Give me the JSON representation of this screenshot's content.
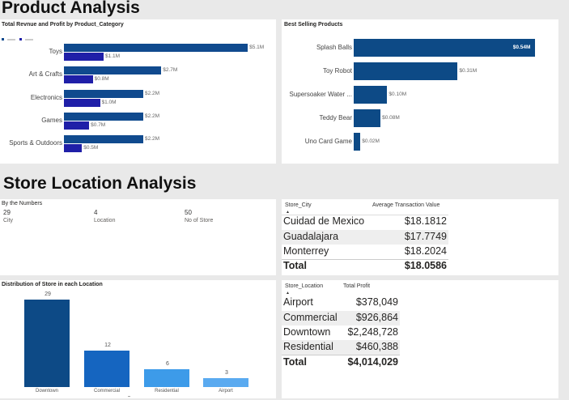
{
  "sections": {
    "product_title": "Product Analysis",
    "store_title": "Store Location Analysis"
  },
  "revenue_chart": {
    "title": "Total Revnue and Profit by Product_Category",
    "colors": {
      "revenue": "#104a8e",
      "profit": "#1f1fa8"
    }
  },
  "best_selling": {
    "title": "Best Selling Products",
    "color": "#0d4a86"
  },
  "numbers": {
    "title": "By the Numbers",
    "items": [
      {
        "value": "29",
        "label": "City"
      },
      {
        "value": "4",
        "label": "Location"
      },
      {
        "value": "50",
        "label": "No of Store"
      }
    ]
  },
  "city_table": {
    "headers": [
      "Store_City",
      "Average Transaction Value"
    ],
    "rows": [
      [
        "Cuidad de Mexico",
        "$18.1812"
      ],
      [
        "Guadalajara",
        "$17.7749"
      ],
      [
        "Monterrey",
        "$18.2024"
      ]
    ],
    "total": [
      "Total",
      "$18.0586"
    ]
  },
  "location_table": {
    "headers": [
      "Store_Location",
      "Total Profit"
    ],
    "rows": [
      [
        "Airport",
        "$378,049"
      ],
      [
        "Commercial",
        "$926,864"
      ],
      [
        "Downtown",
        "$2,248,728"
      ],
      [
        "Residential",
        "$460,388"
      ]
    ],
    "total": [
      "Total",
      "$4,014,029"
    ]
  },
  "distribution": {
    "title": "Distribution of Store in each Location",
    "colors": [
      "#0d4a86",
      "#1565c0",
      "#3d9be9",
      "#5aaaf0"
    ]
  },
  "chart_data": [
    {
      "type": "bar",
      "orientation": "horizontal",
      "title": "Total Revnue and Profit by Product_Category",
      "categories": [
        "Toys",
        "Art & Crafts",
        "Electronics",
        "Games",
        "Sports & Outdoors"
      ],
      "series": [
        {
          "values": [
            5.1,
            2.7,
            2.2,
            2.2,
            2.2
          ],
          "labels": [
            "$5.1M",
            "$2.7M",
            "$2.2M",
            "$2.2M",
            "$2.2M"
          ]
        },
        {
          "values": [
            1.1,
            0.8,
            1.0,
            0.7,
            0.5
          ],
          "labels": [
            "$1.1M",
            "$0.8M",
            "$1.0M",
            "$0.7M",
            "$0.5M"
          ]
        }
      ],
      "xlim": [
        0,
        5.3
      ]
    },
    {
      "type": "bar",
      "orientation": "horizontal",
      "title": "Best Selling Products",
      "categories": [
        "Splash Balls",
        "Toy Robot",
        "Supersoaker Water ...",
        "Teddy Bear",
        "Uno Card Game"
      ],
      "values": [
        0.54,
        0.31,
        0.1,
        0.08,
        0.02
      ],
      "labels": [
        "$0.54M",
        "$0.31M",
        "$0.10M",
        "$0.08M",
        "$0.02M"
      ],
      "xlim": [
        0,
        0.56
      ]
    },
    {
      "type": "bar",
      "title": "Distribution of Store in each Location",
      "categories": [
        "Downtown",
        "Commercial",
        "Residential",
        "Airport"
      ],
      "values": [
        29,
        12,
        6,
        3
      ],
      "ylim": [
        0,
        29
      ]
    }
  ]
}
